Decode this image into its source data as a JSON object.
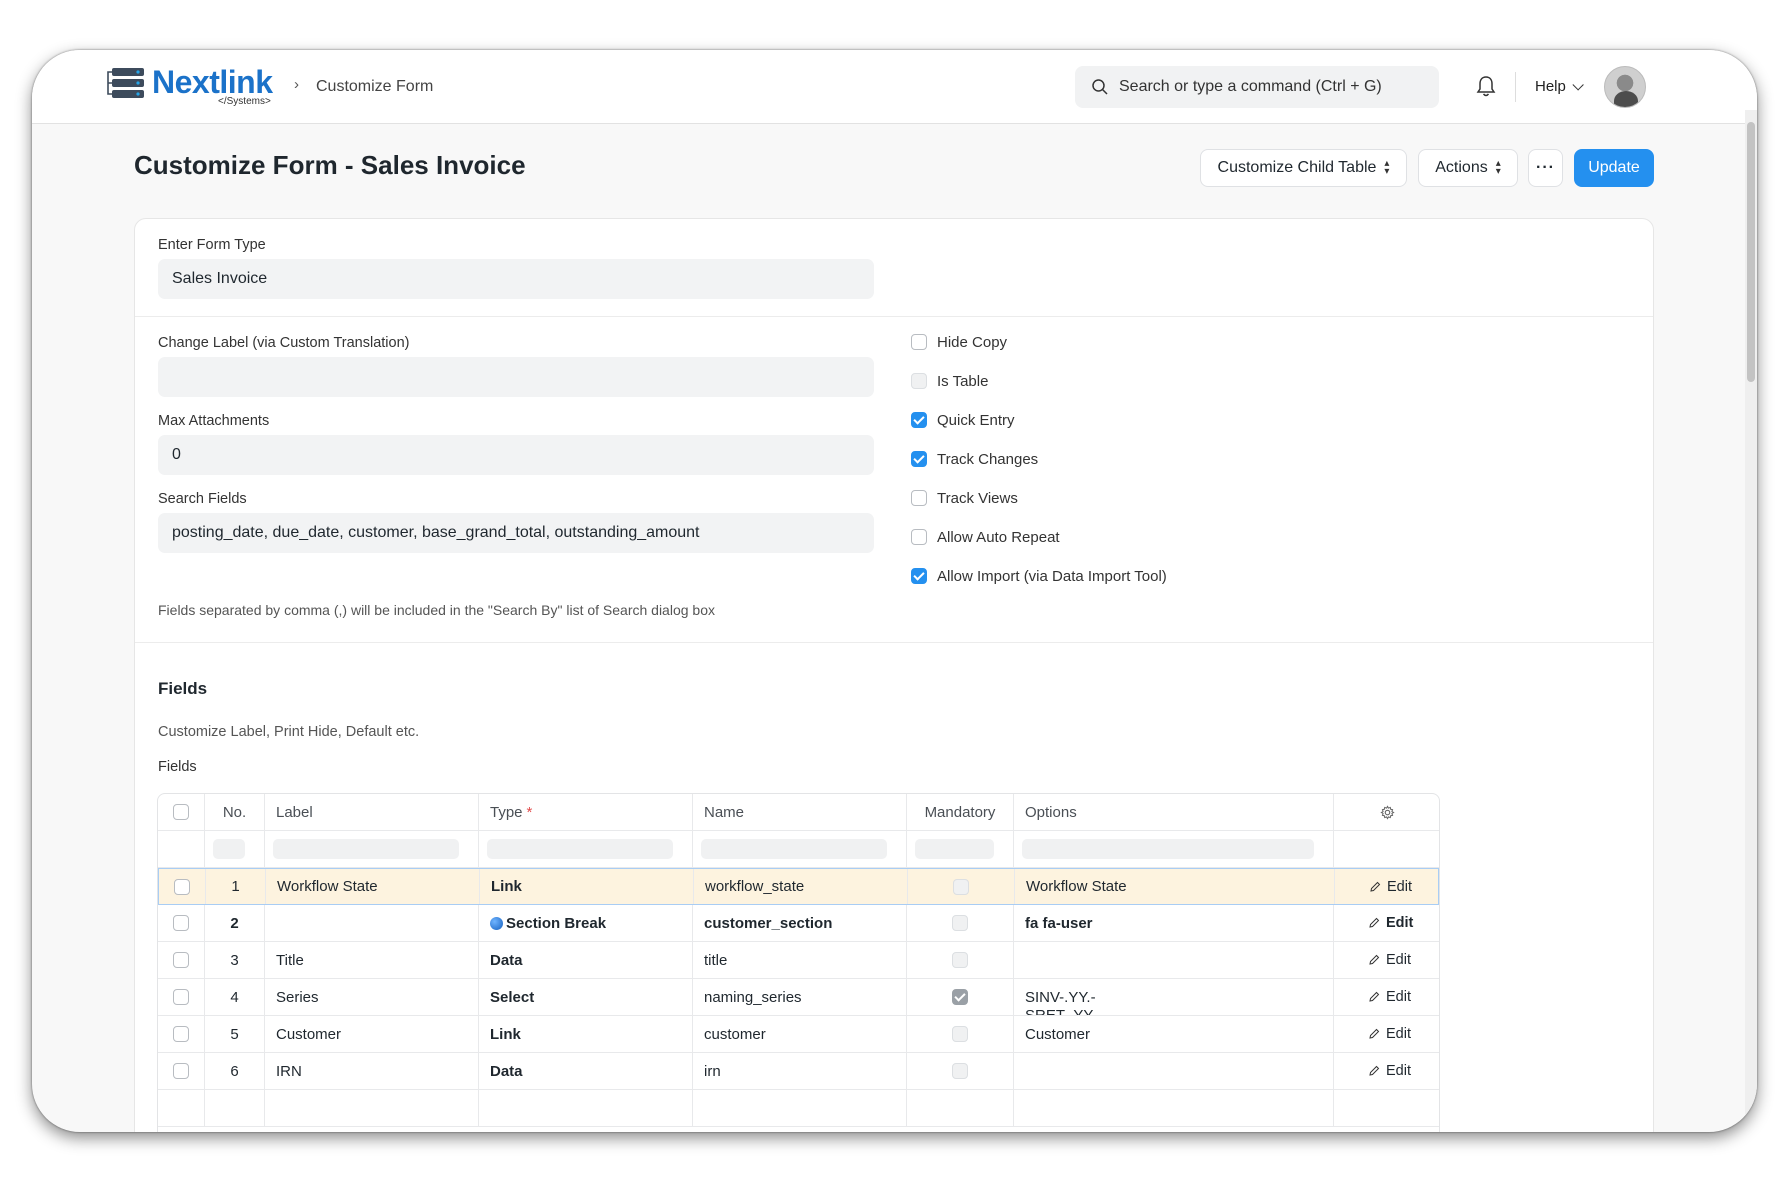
{
  "app": {
    "brand": "Nextlink",
    "brand_sub": "</Systems>",
    "breadcrumb": "Customize Form",
    "search_placeholder": "Search or type a command (Ctrl + G)",
    "help_label": "Help"
  },
  "page": {
    "title": "Customize Form - Sales Invoice",
    "buttons": {
      "customize_child_table": "Customize Child Table",
      "actions": "Actions",
      "more": "···",
      "update": "Update"
    },
    "colors": {
      "primary": "#2490ef",
      "brand": "#1b72c9",
      "highlight_row": "#fdf3df"
    }
  },
  "form": {
    "form_type_label": "Enter Form Type",
    "form_type_value": "Sales Invoice",
    "change_label_label": "Change Label (via Custom Translation)",
    "change_label_value": "",
    "max_attachments_label": "Max Attachments",
    "max_attachments_value": "0",
    "search_fields_label": "Search Fields",
    "search_fields_value": "posting_date, due_date, customer, base_grand_total, outstanding_amount",
    "search_fields_desc": "Fields separated by comma (,) will be included in the \"Search By\" list of Search dialog box",
    "checkboxes": [
      {
        "label": "Hide Copy",
        "checked": false,
        "disabled": false
      },
      {
        "label": "Is Table",
        "checked": false,
        "disabled": true
      },
      {
        "label": "Quick Entry",
        "checked": true,
        "disabled": false
      },
      {
        "label": "Track Changes",
        "checked": true,
        "disabled": false
      },
      {
        "label": "Track Views",
        "checked": false,
        "disabled": false
      },
      {
        "label": "Allow Auto Repeat",
        "checked": false,
        "disabled": false
      },
      {
        "label": "Allow Import (via Data Import Tool)",
        "checked": true,
        "disabled": false
      }
    ]
  },
  "fields_section": {
    "title": "Fields",
    "description": "Customize Label, Print Hide, Default etc.",
    "table_label": "Fields",
    "columns": {
      "no": "No.",
      "label": "Label",
      "type": "Type",
      "type_required_mark": "*",
      "name": "Name",
      "mandatory": "Mandatory",
      "options": "Options"
    },
    "edit_label": "Edit",
    "rows": [
      {
        "no": "1",
        "label": "Workflow State",
        "type": "Link",
        "name": "workflow_state",
        "mandatory": false,
        "options": "Workflow State",
        "highlighted": true
      },
      {
        "no": "2",
        "label": "",
        "type": "Section Break",
        "name": "customer_section",
        "mandatory": false,
        "options": "fa fa-user",
        "bold_row": true
      },
      {
        "no": "3",
        "label": "Title",
        "type": "Data",
        "name": "title",
        "mandatory": false,
        "options": ""
      },
      {
        "no": "4",
        "label": "Series",
        "type": "Select",
        "name": "naming_series",
        "mandatory": true,
        "options": "SINV-.YY.-\nSRET-.YY.-"
      },
      {
        "no": "5",
        "label": "Customer",
        "type": "Link",
        "name": "customer",
        "mandatory": false,
        "options": "Customer"
      },
      {
        "no": "6",
        "label": "IRN",
        "type": "Data",
        "name": "irn",
        "mandatory": false,
        "options": ""
      }
    ]
  }
}
